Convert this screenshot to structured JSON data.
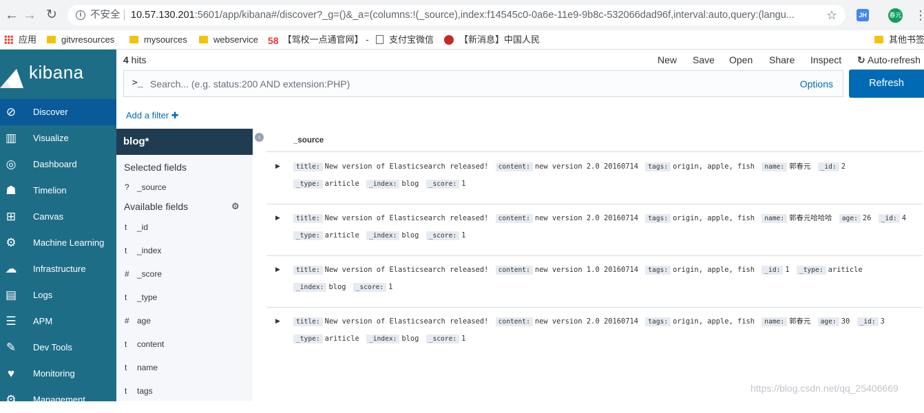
{
  "browser": {
    "insecure_label": "不安全",
    "url_host": "10.57.130.201",
    "url_rest": ":5601/app/kibana#/discover?_g=()&_a=(columns:!(_source),index:f14545c0-0a6e-11e9-9b8c-532066dad96f,interval:auto,query:(langu...",
    "ext_label": "JH",
    "avatar_label": "春元",
    "bookmarks": [
      "应用",
      "gitvresources",
      "mysources",
      "webservice",
      "【驾校一点通官网】 -",
      "支付宝微信",
      "【新消息】中国人民",
      "其他书签"
    ]
  },
  "kibana": {
    "logo_text": "kibana",
    "nav": [
      {
        "label": "Discover",
        "icon": "compass-icon",
        "active": true
      },
      {
        "label": "Visualize",
        "icon": "bar-chart-icon"
      },
      {
        "label": "Dashboard",
        "icon": "dashboard-icon"
      },
      {
        "label": "Timelion",
        "icon": "timelion-icon"
      },
      {
        "label": "Canvas",
        "icon": "canvas-icon"
      },
      {
        "label": "Machine Learning",
        "icon": "machine-learning-icon"
      },
      {
        "label": "Infrastructure",
        "icon": "infrastructure-icon"
      },
      {
        "label": "Logs",
        "icon": "logs-icon"
      },
      {
        "label": "APM",
        "icon": "apm-icon"
      },
      {
        "label": "Dev Tools",
        "icon": "wrench-icon"
      },
      {
        "label": "Monitoring",
        "icon": "heartbeat-icon"
      },
      {
        "label": "Management",
        "icon": "gear-icon"
      }
    ]
  },
  "topbar": {
    "hits_count": "4",
    "hits_label": " hits",
    "menu": [
      "New",
      "Save",
      "Open",
      "Share",
      "Inspect",
      "Auto-refresh"
    ],
    "search_placeholder": "Search... (e.g. status:200 AND extension:PHP)",
    "options_label": "Options",
    "refresh_label": "Refresh",
    "add_filter_label": "Add a filter"
  },
  "fields": {
    "index_pattern": "blog*",
    "selected_heading": "Selected fields",
    "selected": [
      {
        "type": "?",
        "name": "_source"
      }
    ],
    "available_heading": "Available fields",
    "available": [
      {
        "type": "t",
        "name": "_id"
      },
      {
        "type": "t",
        "name": "_index"
      },
      {
        "type": "#",
        "name": "_score"
      },
      {
        "type": "t",
        "name": "_type"
      },
      {
        "type": "#",
        "name": "age"
      },
      {
        "type": "t",
        "name": "content"
      },
      {
        "type": "t",
        "name": "name"
      },
      {
        "type": "t",
        "name": "tags"
      }
    ]
  },
  "documents": {
    "column": "_source",
    "rows": [
      [
        [
          "title:",
          "New version of Elasticsearch released!"
        ],
        [
          "content:",
          "new version 2.0 20160714"
        ],
        [
          "tags:",
          "origin, apple, fish"
        ],
        [
          "name:",
          "郭春元"
        ],
        [
          "_id:",
          "2"
        ],
        [
          "_type:",
          "ariticle"
        ],
        [
          "_index:",
          "blog"
        ],
        [
          "_score:",
          "1"
        ]
      ],
      [
        [
          "title:",
          "New version of Elasticsearch released!"
        ],
        [
          "content:",
          "new version 2.0 20160714"
        ],
        [
          "tags:",
          "origin, apple, fish"
        ],
        [
          "name:",
          "郭春元哈哈哈"
        ],
        [
          "age:",
          "26"
        ],
        [
          "_id:",
          "4"
        ],
        [
          "_type:",
          "ariticle"
        ],
        [
          "_index:",
          "blog"
        ],
        [
          "_score:",
          "1"
        ]
      ],
      [
        [
          "title:",
          "New version of Elasticsearch released!"
        ],
        [
          "content:",
          "new version 1.0 20160714"
        ],
        [
          "tags:",
          "origin, apple, fish"
        ],
        [
          "_id:",
          "1"
        ],
        [
          "_type:",
          "ariticle"
        ],
        [
          "_index:",
          "blog"
        ],
        [
          "_score:",
          "1"
        ]
      ],
      [
        [
          "title:",
          "New version of Elasticsearch released!"
        ],
        [
          "content:",
          "new version 2.0 20160714"
        ],
        [
          "tags:",
          "origin, apple, fish"
        ],
        [
          "name:",
          "郭春元"
        ],
        [
          "age:",
          "30"
        ],
        [
          "_id:",
          "3"
        ],
        [
          "_type:",
          "ariticle"
        ],
        [
          "_index:",
          "blog"
        ],
        [
          "_score:",
          "1"
        ]
      ]
    ]
  },
  "watermark": "https://blog.csdn.net/qq_25406669"
}
